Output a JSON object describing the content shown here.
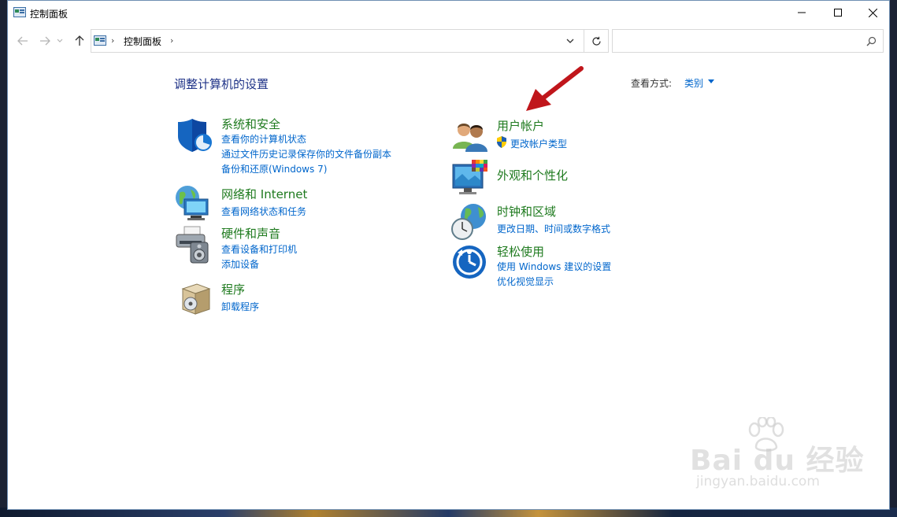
{
  "window": {
    "title": "控制面板"
  },
  "address": {
    "path": "控制面板",
    "search_placeholder": ""
  },
  "main": {
    "heading": "调整计算机的设置",
    "view_by_label": "查看方式:",
    "view_by_value": "类别"
  },
  "categories": {
    "system": {
      "title": "系统和安全",
      "links": [
        "查看你的计算机状态",
        "通过文件历史记录保存你的文件备份副本",
        "备份和还原(Windows 7)"
      ]
    },
    "network": {
      "title": "网络和 Internet",
      "links": [
        "查看网络状态和任务"
      ]
    },
    "hardware": {
      "title": "硬件和声音",
      "links": [
        "查看设备和打印机",
        "添加设备"
      ]
    },
    "programs": {
      "title": "程序",
      "links": [
        "卸载程序"
      ]
    },
    "users": {
      "title": "用户帐户",
      "links": [
        "更改帐户类型"
      ]
    },
    "appearance": {
      "title": "外观和个性化",
      "links": []
    },
    "clock": {
      "title": "时钟和区域",
      "links": [
        "更改日期、时间或数字格式"
      ]
    },
    "ease": {
      "title": "轻松使用",
      "links": [
        "使用 Windows 建议的设置",
        "优化视觉显示"
      ]
    }
  },
  "watermark": {
    "main": "Bai du 经验",
    "sub": "jingyan.baidu.com"
  },
  "colors": {
    "category_title": "#1e7a1e",
    "link": "#0066cc",
    "heading": "#1e3287",
    "arrow": "#c0161b"
  }
}
